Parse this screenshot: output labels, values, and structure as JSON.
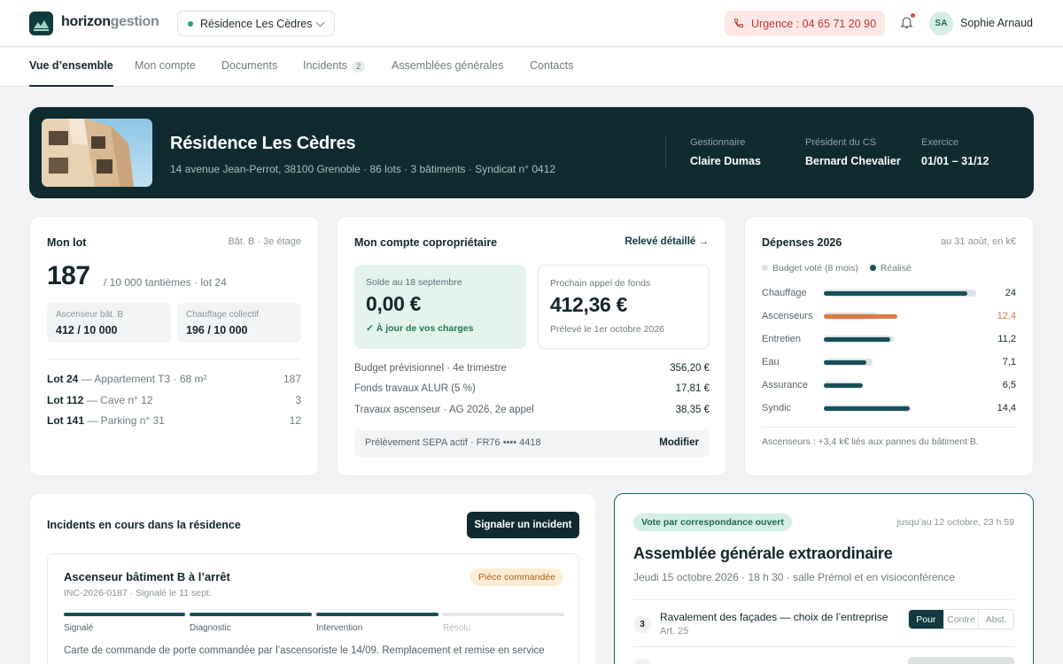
{
  "brand": {
    "name_bold": "horizon",
    "name_light": "gestion"
  },
  "residence_select": "Résidence Les Cèdres",
  "urgence": "Urgence : 04 65 71 20 90",
  "user": {
    "initials": "SA",
    "name": "Sophie Arnaud"
  },
  "tabs": [
    {
      "label": "Vue d’ensemble"
    },
    {
      "label": "Mon compte"
    },
    {
      "label": "Documents"
    },
    {
      "label": "Incidents",
      "count": "2"
    },
    {
      "label": "Assemblées générales"
    },
    {
      "label": "Contacts"
    }
  ],
  "hero": {
    "title": "Résidence Les Cèdres",
    "subtitle": "14 avenue Jean-Perrot, 38100 Grenoble · 86 lots · 3 bâtiments · Syndicat n° 0412",
    "facts": [
      {
        "label": "Gestionnaire",
        "value": "Claire Dumas"
      },
      {
        "label": "Président du CS",
        "value": "Bernard Chevalier"
      },
      {
        "label": "Exercice",
        "value": "01/01 – 31/12"
      }
    ]
  },
  "lot": {
    "title": "Mon lot",
    "meta": "Bât. B · 3e étage",
    "tantiemes": "187",
    "tantiemes_sub": "/ 10 000 tantièmes · lot 24",
    "mini": [
      {
        "label": "Ascenseur bât. B",
        "value": "412 / 10 000"
      },
      {
        "label": "Chauffage collectif",
        "value": "196 / 10 000"
      }
    ],
    "rows": [
      {
        "lot": "Lot 24",
        "desc": " — Appartement T3 · 68 m²",
        "value": "187"
      },
      {
        "lot": "Lot 112",
        "desc": " — Cave n° 12",
        "value": "3"
      },
      {
        "lot": "Lot 141",
        "desc": " — Parking n° 31",
        "value": "12"
      }
    ]
  },
  "compte": {
    "title": "Mon compte copropriétaire",
    "link": "Relevé détaillé →",
    "solde_label": "Solde au 18 septembre",
    "solde_value": "0,00 €",
    "solde_status": "✓  À jour de vos charges",
    "appel_label": "Prochain appel de fonds",
    "appel_value": "412,36 €",
    "appel_sub": "Prélevé le 1er octobre 2026",
    "lines": [
      {
        "label": "Budget prévisionnel · 4e trimestre",
        "value": "356,20 €"
      },
      {
        "label": "Fonds travaux ALUR (5 %)",
        "value": "17,81 €"
      },
      {
        "label": "Travaux ascenseur · AG 2026, 2e appel",
        "value": "38,35 €"
      }
    ],
    "sepa": "Prélèvement SEPA actif · FR76 •••• 4418",
    "sepa_action": "Modifier"
  },
  "depenses": {
    "title": "Dépenses 2026",
    "meta": "au 31 août, en k€",
    "legend_budget": "Budget voté (8 mois)",
    "legend_real": "Réalisé",
    "colors": {
      "real": "#17505a",
      "over": "#d97a45",
      "budget": "#dde3e5"
    },
    "rows": [
      {
        "label": "Chauffage",
        "budget": 25.6,
        "value": 24,
        "display": "24"
      },
      {
        "label": "Ascenseurs",
        "budget": 9.0,
        "value": 12.4,
        "display": "12,4",
        "over": true
      },
      {
        "label": "Entretien",
        "budget": 11.8,
        "value": 11.2,
        "display": "11,2"
      },
      {
        "label": "Eau",
        "budget": 8.1,
        "value": 7.1,
        "display": "7,1"
      },
      {
        "label": "Assurance",
        "budget": 6.5,
        "value": 6.5,
        "display": "6,5"
      },
      {
        "label": "Syndic",
        "budget": 14.4,
        "value": 14.4,
        "display": "14,4"
      }
    ],
    "note": "Ascenseurs : +3,4 k€ liés aux pannes du bâtiment B."
  },
  "incidents": {
    "title": "Incidents en cours dans la résidence",
    "button": "Signaler un incident",
    "item": {
      "title": "Ascenseur bâtiment B à l’arrêt",
      "sub": "INC-2026-0187 · Signalé le 11 sept.",
      "status": "Pièce commandée",
      "steps": [
        {
          "label": "Signalé",
          "done": true
        },
        {
          "label": "Diagnostic",
          "done": true
        },
        {
          "label": "Intervention",
          "done": true
        },
        {
          "label": "Résolu",
          "done": false
        }
      ],
      "desc": "Carte de commande de porte commandée par l’ascensoriste le 14/09. Remplacement et remise en service"
    }
  },
  "ag": {
    "badge": "Vote par correspondance ouvert",
    "deadline": "jusqu’au 12 octobre, 23 h 59",
    "title": "Assemblée générale extraordinaire",
    "sub": "Jeudi 15 octobre 2026 · 18 h 30 · salle Prémol et en visioconférence",
    "resolutions": [
      {
        "num": "3",
        "title": "Ravalement des façades — choix de l’entreprise",
        "article": "Art. 25",
        "choices": [
          "Pour",
          "Contre",
          "Abst."
        ],
        "selected": 0
      }
    ]
  }
}
